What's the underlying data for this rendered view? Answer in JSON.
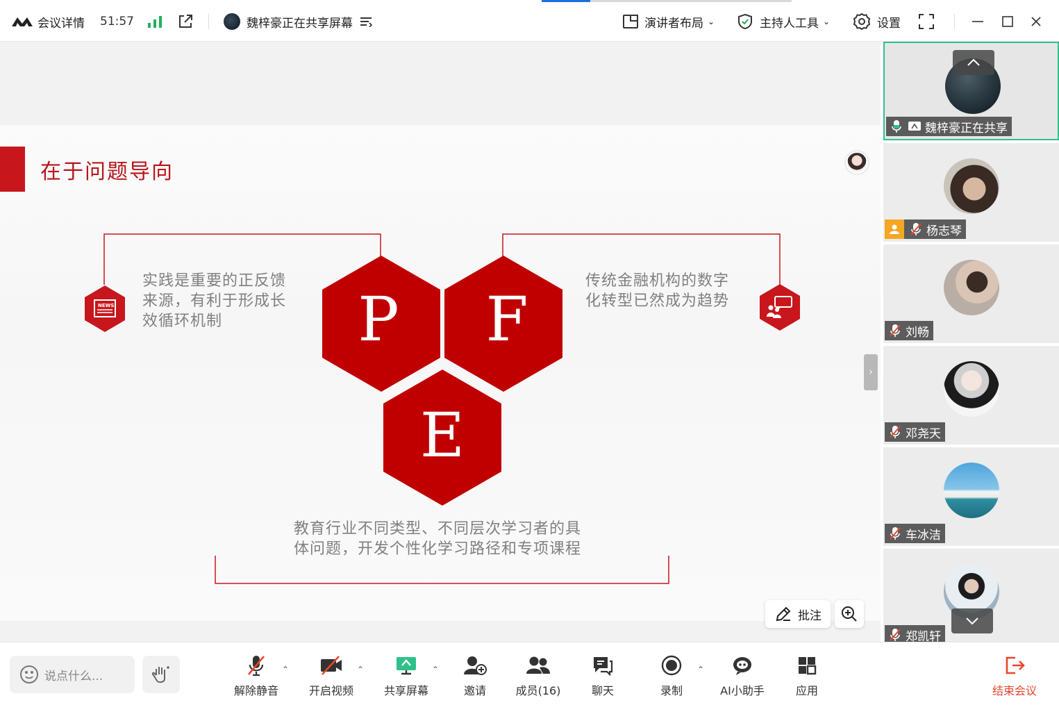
{
  "topbar": {
    "meeting_details": "会议详情",
    "timer": "51:57",
    "sharing_status": "魏梓豪正在共享屏幕",
    "layout_label": "演讲者布局",
    "host_tools_label": "主持人工具",
    "settings_label": "设置"
  },
  "slide": {
    "title": "在于问题导向",
    "text_left": [
      "实践是重要的正反馈",
      "来源，有利于形成长",
      "效循环机制"
    ],
    "text_right": [
      "传统金融机构的数字",
      "化转型已然成为趋势"
    ],
    "text_bottom": [
      "教育行业不同类型、不同层次学习者的具",
      "体问题，开发个性化学习路径和专项课程"
    ],
    "hex_letters": [
      "P",
      "F",
      "E"
    ],
    "news_icon_text": "NEWS"
  },
  "stage_buttons": {
    "annotate_label": "批注"
  },
  "participants": [
    {
      "name": "魏梓豪正在共享",
      "state": "sharing"
    },
    {
      "name": "杨志琴",
      "state": "muted-host"
    },
    {
      "name": "刘畅",
      "state": "muted"
    },
    {
      "name": "邓尧天",
      "state": "muted"
    },
    {
      "name": "车冰洁",
      "state": "muted"
    },
    {
      "name": "郑凯轩",
      "state": "muted"
    }
  ],
  "bottombar": {
    "chat_placeholder": "说点什么...",
    "unmute": "解除静音",
    "start_video": "开启视频",
    "share_screen": "共享屏幕",
    "invite": "邀请",
    "members": "成员(16)",
    "chat": "聊天",
    "record": "录制",
    "ai_assistant": "AI小助手",
    "apps": "应用",
    "end_meeting": "结束会议"
  },
  "colors": {
    "brand_red": "#c8161d",
    "active_green": "#2fc18c",
    "end_red": "#e8472b",
    "signal_green": "#20b05a"
  }
}
